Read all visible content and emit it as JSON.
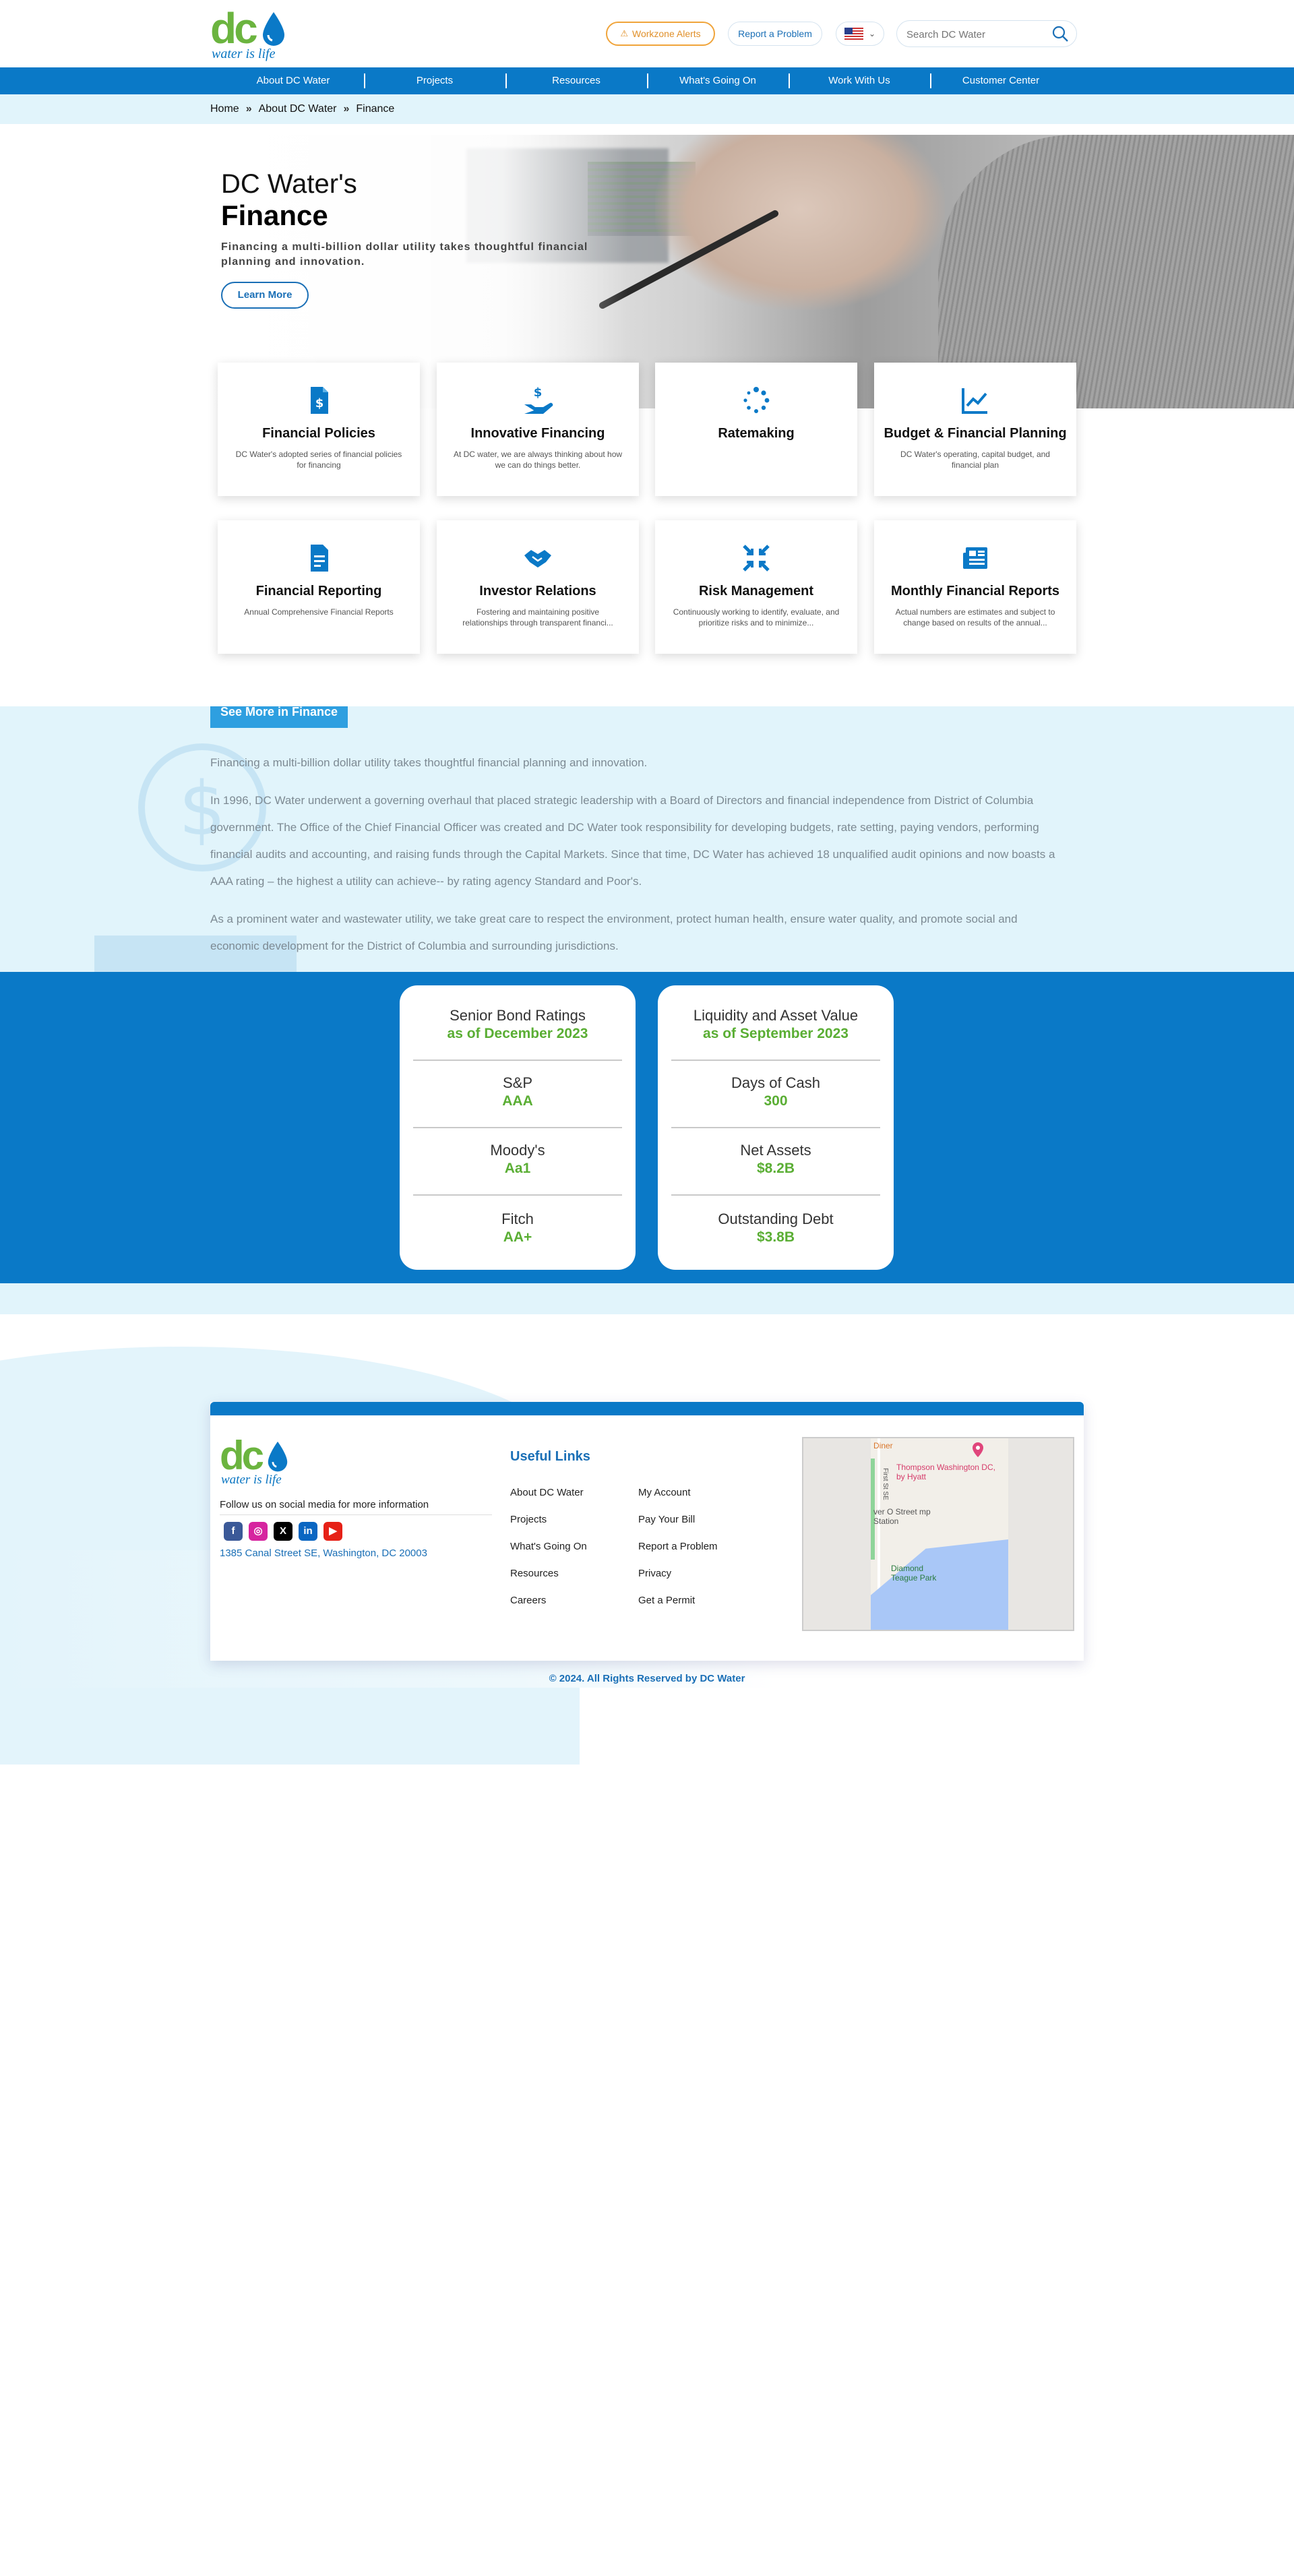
{
  "header": {
    "logo_text": "dc",
    "logo_tagline": "water is life",
    "alerts_label": "Workzone Alerts",
    "report_label": "Report a Problem",
    "search_placeholder": "Search DC Water"
  },
  "nav": {
    "items": [
      "About DC Water",
      "Projects",
      "Resources",
      "What's Going On",
      "Work With Us",
      "Customer Center"
    ]
  },
  "breadcrumb": [
    "Home",
    "About DC Water",
    "Finance"
  ],
  "hero": {
    "title_line1": "DC Water's",
    "title_line2": "Finance",
    "subtitle": "Financing a multi-billion dollar utility takes thoughtful financial planning and innovation.",
    "button": "Learn More"
  },
  "cards": [
    {
      "icon": "dollar-document-icon",
      "title": "Financial Policies",
      "desc": "DC Water's adopted series of financial policies for financing"
    },
    {
      "icon": "hand-dollar-icon",
      "title": "Innovative Financing",
      "desc": "At DC water, we are always thinking about how we can do things better."
    },
    {
      "icon": "loading-dots-icon",
      "title": "Ratemaking",
      "desc": ""
    },
    {
      "icon": "line-chart-icon",
      "title": "Budget & Financial Planning",
      "desc": "DC Water's operating, capital budget, and financial plan"
    },
    {
      "icon": "document-icon",
      "title": "Financial Reporting",
      "desc": "Annual Comprehensive Financial Reports"
    },
    {
      "icon": "handshake-icon",
      "title": "Investor Relations",
      "desc": "Fostering and maintaining positive relationships through transparent financi..."
    },
    {
      "icon": "compress-arrows-icon",
      "title": "Risk Management",
      "desc": "Continuously working to identify, evaluate, and prioritize risks and to minimize..."
    },
    {
      "icon": "newspaper-icon",
      "title": "Monthly Financial Reports",
      "desc": "Actual numbers are estimates and subject to change based on results of the annual..."
    }
  ],
  "see_more": {
    "tab": "See More in Finance",
    "p1": "Financing a multi-billion dollar utility takes thoughtful financial planning and innovation.",
    "p2": "In 1996,  DC Water underwent a governing overhaul that placed strategic leadership with a Board of Directors and financial independence from District of Columbia government. The Office of the Chief Financial Officer was created and DC Water took responsibility for developing budgets, rate setting, paying vendors, performing financial audits and accounting, and raising funds through the Capital Markets.  Since that time, DC Water has achieved 18 unqualified audit opinions and now boasts a AAA rating – the highest a utility can achieve-- by rating agency Standard and Poor's.",
    "p3": "As a prominent water and wastewater utility, we take great care to respect the environment, protect human health, ensure water quality, and promote social and economic development for the District of Columbia and surrounding jurisdictions."
  },
  "ratings": {
    "title": "Senior Bond Ratings",
    "subtitle": "as of December 2023",
    "rows": [
      {
        "label": "S&P",
        "value": "AAA"
      },
      {
        "label": "Moody's",
        "value": "Aa1"
      },
      {
        "label": "Fitch",
        "value": "AA+"
      }
    ]
  },
  "liquidity": {
    "title": "Liquidity and Asset Value",
    "subtitle": "as of September 2023",
    "rows": [
      {
        "label": "Days of Cash",
        "value": "300"
      },
      {
        "label": "Net Assets",
        "value": "$8.2B"
      },
      {
        "label": "Outstanding Debt",
        "value": "$3.8B"
      }
    ]
  },
  "footer": {
    "follow": "Follow us on social media for more information",
    "address": "1385 Canal Street SE, Washington, DC 20003",
    "useful_links_title": "Useful Links",
    "links_col1": [
      "About DC Water",
      "Projects",
      "What's Going On",
      "Resources",
      "Careers"
    ],
    "links_col2": [
      "My Account",
      "Pay Your Bill",
      "Report a Problem",
      "Privacy",
      "Get a Permit"
    ],
    "socials": [
      {
        "name": "facebook-icon",
        "glyph": "f",
        "color": "#3b5998"
      },
      {
        "name": "instagram-icon",
        "glyph": "◎",
        "color": "#d6249f"
      },
      {
        "name": "x-icon",
        "glyph": "X",
        "color": "#000000"
      },
      {
        "name": "linkedin-icon",
        "glyph": "in",
        "color": "#0a66c2"
      },
      {
        "name": "youtube-icon",
        "glyph": "▶",
        "color": "#e62117"
      }
    ],
    "map_labels": {
      "diner": "Diner",
      "hotel": "Thompson Washington DC, by Hyatt",
      "station": "ver O Street mp Station",
      "park": "Diamond Teague Park",
      "street": "First St SE"
    },
    "copyright": "© 2024. All Rights Reserved by DC Water"
  },
  "colors": {
    "brand_blue": "#0a79c7",
    "brand_green": "#6bb43f",
    "light_bg": "#e1f4fb",
    "alert_orange": "#f0a43a"
  }
}
